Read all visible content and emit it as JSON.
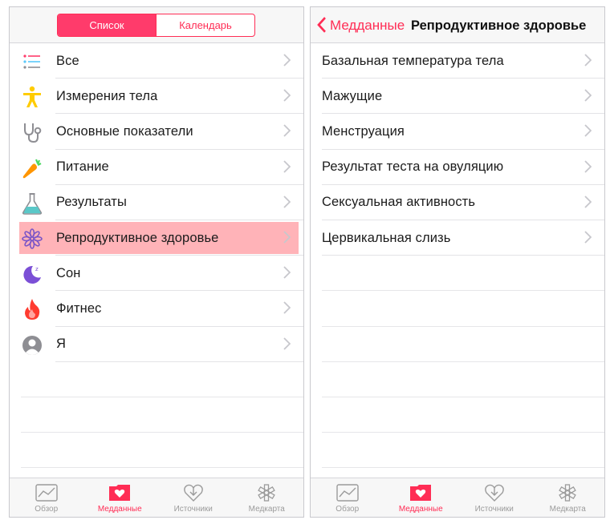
{
  "left": {
    "segmented": {
      "list": "Список",
      "calendar": "Календарь",
      "active": "list"
    },
    "categories": [
      {
        "label": "Все",
        "icon": "list-icon"
      },
      {
        "label": "Измерения тела",
        "icon": "body-figure-icon"
      },
      {
        "label": "Основные показатели",
        "icon": "stethoscope-icon"
      },
      {
        "label": "Питание",
        "icon": "carrot-icon"
      },
      {
        "label": "Результаты",
        "icon": "flask-icon"
      },
      {
        "label": "Репродуктивное здоровье",
        "icon": "flower-icon",
        "highlighted": true
      },
      {
        "label": "Сон",
        "icon": "moon-icon"
      },
      {
        "label": "Фитнес",
        "icon": "flame-icon"
      },
      {
        "label": "Я",
        "icon": "person-icon"
      }
    ]
  },
  "right": {
    "navbar": {
      "back_label": "Медданные",
      "title": "Репродуктивное здоровье"
    },
    "items": [
      "Базальная температура тела",
      "Мажущие",
      "Менструация",
      "Результат теста на овуляцию",
      "Сексуальная активность",
      "Цервикальная слизь"
    ]
  },
  "tabbar": {
    "tabs": [
      {
        "label": "Обзор",
        "icon": "dashboard-icon"
      },
      {
        "label": "Медданные",
        "icon": "health-data-icon",
        "active": true
      },
      {
        "label": "Источники",
        "icon": "sources-icon"
      },
      {
        "label": "Медкарта",
        "icon": "medical-id-icon"
      }
    ]
  },
  "colors": {
    "accent": "#ff2d55",
    "highlight": "#ffb3b8",
    "inactive": "#9b9b9b"
  }
}
